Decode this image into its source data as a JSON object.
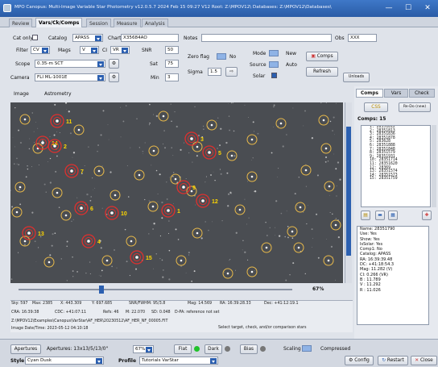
{
  "titlebar": {
    "title": "MPO Canopus: Multi-Image Variable Star Photometry  v12.0.5.7  2024 Feb 15  09:27    V12 Root: Z:\\MPOV12\\  Databases: Z:\\MPOV12\\Databases\\",
    "minimize": "—",
    "maximize": "☐",
    "close": "✕"
  },
  "tabs": [
    "Review",
    "Vars/Ck/Comps",
    "Session",
    "Measure",
    "Analysis"
  ],
  "controls": {
    "cat_only_label": "Cat only",
    "catalog_label": "Catalog",
    "catalog_value": "APASS",
    "chart_label": "Chart",
    "chart_value": "X35684AO",
    "notes_label": "Notes",
    "notes_value": "",
    "obs_label": "Obs",
    "obs_value": "XXX",
    "filter_label": "Filter",
    "filter_value": "CV",
    "mags_label": "Mags",
    "mags_value": "V",
    "ci_label": "CI",
    "ci_value": "VR",
    "snr_label": "SNR",
    "snr_value": "50",
    "scope_label": "Scope",
    "scope_value": "0.35-m SCT",
    "sat_label": "Sat",
    "sat_value": "75",
    "camera_label": "Camera",
    "camera_value": "FLI ML-1001E",
    "min_label": "Min",
    "min_value": "3",
    "zero_flag_label": "Zero flag",
    "no_label": "No",
    "sigma_label": "Sigma",
    "sigma_value": "1.5",
    "mode_label": "Mode",
    "new_label": "New",
    "source_label": "Source",
    "auto_label": "Auto",
    "solar_label": "Solar",
    "comps_btn": "Comps",
    "refresh_btn": "Refresh",
    "unloads_btn": "Unloads"
  },
  "image_tabs": [
    "Image",
    "Astrometry"
  ],
  "stars": [
    {
      "label": "11"
    },
    {
      "label": "14"
    },
    {
      "label": "2"
    },
    {
      "label": "3"
    },
    {
      "label": "5"
    },
    {
      "label": "7"
    },
    {
      "label": "9"
    },
    {
      "label": "12"
    },
    {
      "label": "6"
    },
    {
      "label": "10"
    },
    {
      "label": "1"
    },
    {
      "label": "13"
    },
    {
      "label": "4"
    },
    {
      "label": "15"
    }
  ],
  "zoom": {
    "percent": "67%"
  },
  "status": {
    "row1": [
      "Sky: 597",
      "Max: 2385",
      "X: 443.309",
      "Y: 697.685",
      "SNR/FWHM: 95/3.8",
      "Mag: 14.569",
      "RA: 16:39:28.33",
      "Dec: +41:12:19.1"
    ],
    "row2": [
      "CRA: 16:39:38",
      "CDC: +41:07:11",
      "Refs: 46",
      "M: 22.070",
      "SD: 0.048",
      "D-PA: reference not set"
    ],
    "path": "Z:\\MPOV12\\Examples\\Canopus\\VarStar\\AF_HER\\20230512\\AF_HER_NF_00005.FIT",
    "image_date": "Image Date/Time: 2023-05-12  04:10:18",
    "hint": "Select target, check, and/or comparison stars"
  },
  "right": {
    "tabs": [
      "Comps",
      "Vars",
      "Check"
    ],
    "btn_css": "CSS",
    "btn_refresh": "Re-Do (new)",
    "comps_title": "Comps: 15",
    "comps": [
      "1: 28351812",
      "2: 28351813",
      "3: 28351836",
      "4: 28351878",
      "5: 283628",
      "6: 28351888",
      "7: 28351848",
      "8: 28351579",
      "9: 28351931",
      "10: 28351714",
      "11: 28351620",
      "12: 28369",
      "13: 28351574",
      "14: 28351573",
      "15: 28351759"
    ],
    "info": [
      "Name: 28351790",
      "Use: Yes",
      "Show: Yes",
      "IsSolar: Yes",
      "Comp1: No",
      "Catalog: APASS",
      "RA: 16:39:39.48",
      "DC: +41:18:54.3",
      "Mag: 11.282 (V)",
      "CI: 0.266 (VR)",
      "B  : 11.789",
      "V  : 11.292",
      "R  : 11.026"
    ]
  },
  "bottom": {
    "apertures_btn": "Apertures",
    "apertures_text": "Apertures: 13x13/5/13/0\"",
    "zoom_value": "67%",
    "flat_btn": "Flat",
    "dark_btn": "Dark",
    "bias_btn": "Bias",
    "scaling_label": "Scaling",
    "compressed_label": "Compressed",
    "style_label": "Style",
    "style_value": "Cyan Dusk",
    "profile_label": "Profile",
    "profile_value": "Tutorials VarStar",
    "config_btn": "Config",
    "restart_btn": "Restart",
    "close_btn": "Close"
  },
  "colors": {
    "title_blue": "#2a5ca6",
    "star_ring_yellow": "#e8b94a",
    "target_ring_red": "#e0302e",
    "label_yellow": "#ffd700",
    "flat_green": "#21c22b",
    "dark_gray": "#777",
    "bias_gray": "#777"
  }
}
